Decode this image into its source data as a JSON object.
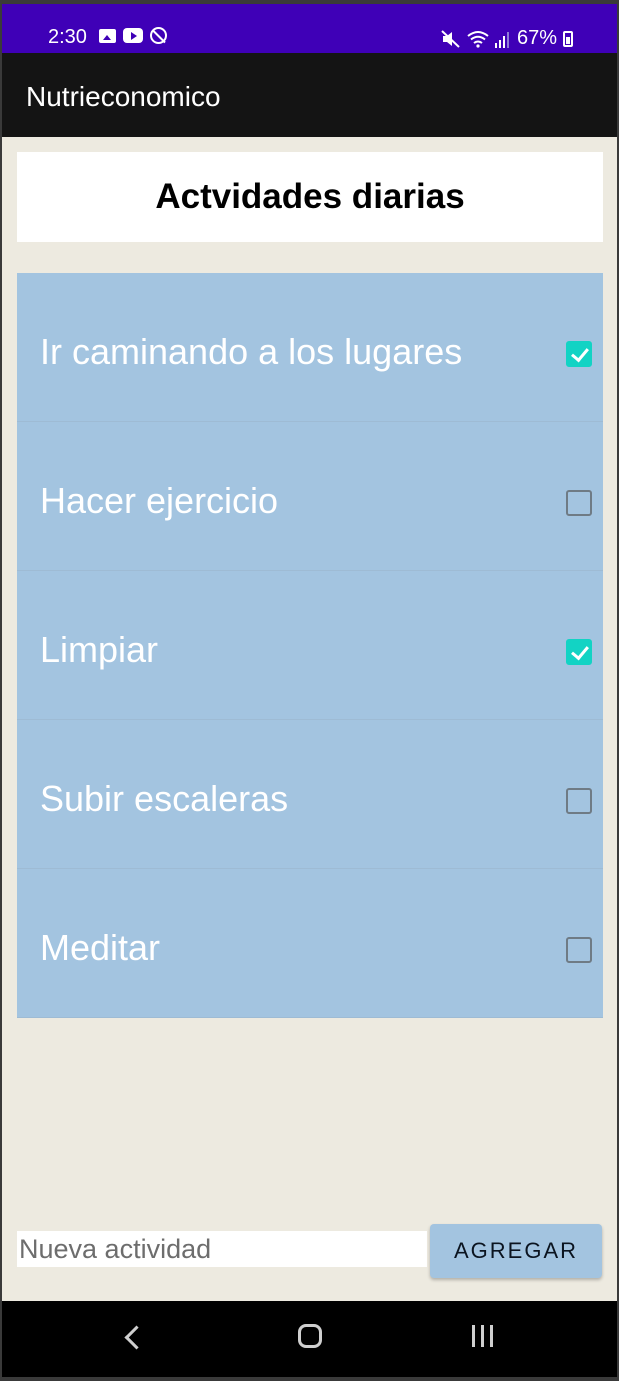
{
  "status_bar": {
    "time": "2:30",
    "battery": "67%",
    "left_icons": [
      "gallery-icon",
      "youtube-icon",
      "no-disturb-icon"
    ],
    "right_icons": [
      "mute-icon",
      "wifi-icon",
      "signal-icon",
      "battery-icon"
    ]
  },
  "app_bar": {
    "title": "Nutrieconomico"
  },
  "header": {
    "title": "Actvidades diarias"
  },
  "activities": [
    {
      "label": "Ir caminando a los lugares",
      "checked": true
    },
    {
      "label": "Hacer ejercicio",
      "checked": false
    },
    {
      "label": "Limpiar",
      "checked": true
    },
    {
      "label": "Subir escaleras",
      "checked": false
    },
    {
      "label": "Meditar",
      "checked": false
    }
  ],
  "new_activity": {
    "placeholder": "Nueva actividad",
    "value": ""
  },
  "add_button": {
    "label": "AGREGAR"
  },
  "nav_bar": {
    "icons": [
      "back-icon",
      "home-icon",
      "recents-icon"
    ]
  },
  "colors": {
    "status_bar": "#3f00b7",
    "app_bar": "#141414",
    "background": "#edeae0",
    "item_background": "#a3c4e0",
    "checkbox_checked": "#12d3c4"
  }
}
